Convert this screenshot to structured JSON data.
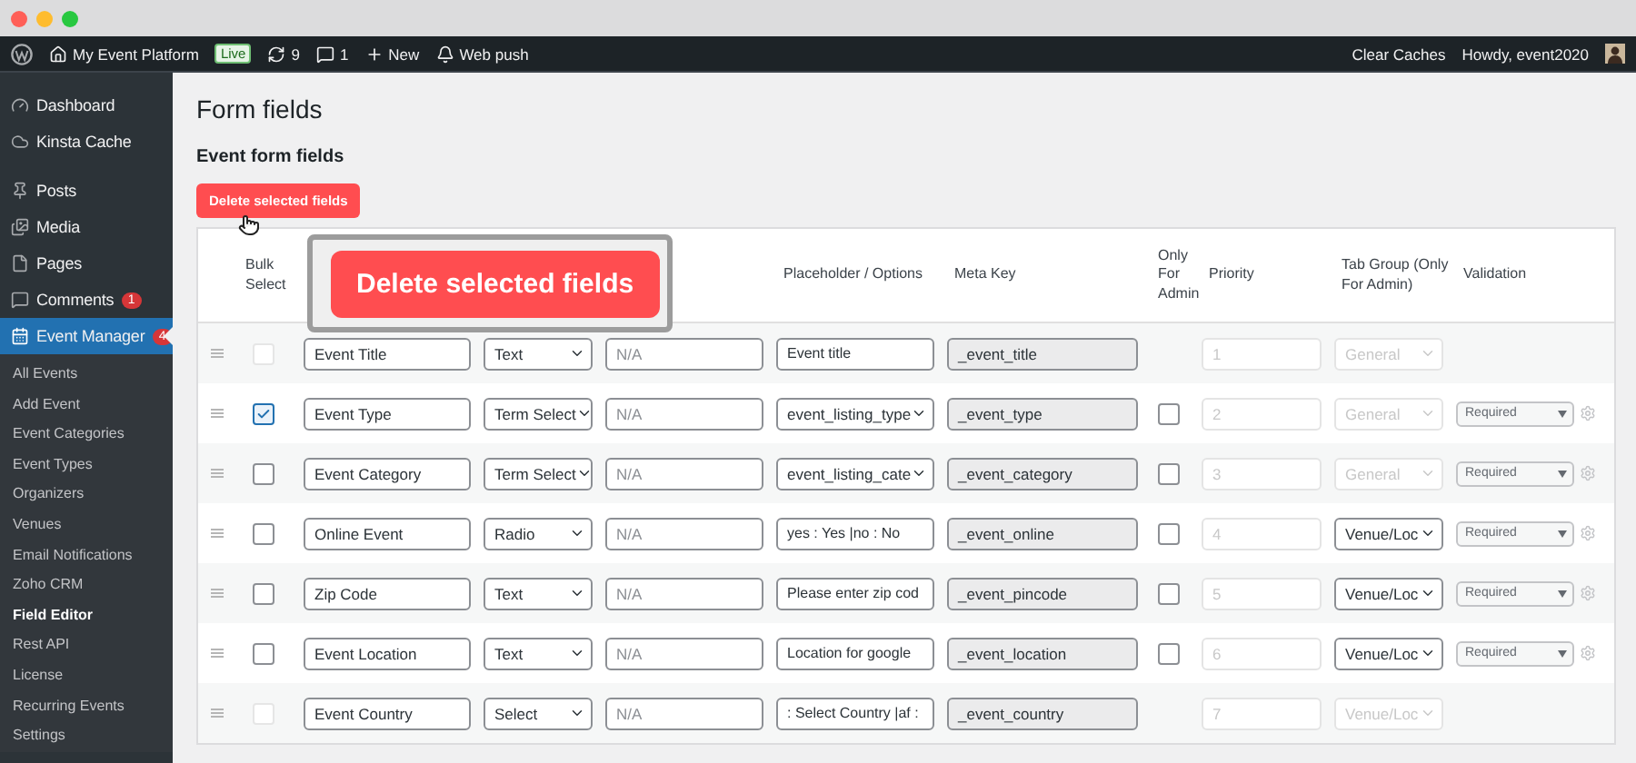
{
  "admin_bar": {
    "site": "My Event Platform",
    "badge": "Live",
    "updates": "9",
    "comments": "1",
    "new": "New",
    "push": "Web push",
    "clear": "Clear Caches",
    "greeting": "Howdy, event2020"
  },
  "sidebar": {
    "items": [
      {
        "label": "Dashboard",
        "selected": false
      },
      {
        "label": "Kinsta Cache",
        "selected": false
      },
      {
        "label": "Posts",
        "selected": false
      },
      {
        "label": "Media",
        "selected": false
      },
      {
        "label": "Pages",
        "selected": false
      },
      {
        "label": "Comments",
        "selected": false,
        "count": "1"
      },
      {
        "label": "Event Manager",
        "selected": true,
        "count": "4"
      }
    ],
    "submenu": [
      {
        "label": "All Events",
        "selected": false
      },
      {
        "label": "Add Event",
        "selected": false
      },
      {
        "label": "Event Categories",
        "selected": false
      },
      {
        "label": "Event Types",
        "selected": false
      },
      {
        "label": "Organizers",
        "selected": false
      },
      {
        "label": "Venues",
        "selected": false
      },
      {
        "label": "Email Notifications",
        "selected": false
      },
      {
        "label": "Zoho CRM",
        "selected": false
      },
      {
        "label": "Field Editor",
        "selected": true
      },
      {
        "label": "Rest API",
        "selected": false
      },
      {
        "label": "License",
        "selected": false
      },
      {
        "label": "Recurring Events",
        "selected": false
      },
      {
        "label": "Settings",
        "selected": false
      }
    ]
  },
  "page": {
    "title": "Form fields",
    "section": "Event form fields",
    "delete_button": "Delete selected fields",
    "popup_button": "Delete selected fields"
  },
  "table": {
    "headers": {
      "bulk_select": "Bulk Select",
      "placeholder_options": "Placeholder / Options",
      "meta_key": "Meta Key",
      "only_for_admin": "Only For Admin",
      "priority": "Priority",
      "tab_group": "Tab Group (Only For Admin)",
      "validation": "Validation"
    },
    "rows": [
      {
        "disabled": true,
        "selected": false,
        "label": "Event Title",
        "type": "Text",
        "description_placeholder": "N/A",
        "options": {
          "kind": "input",
          "value": "Event title"
        },
        "meta_key": "_event_title",
        "priority": "1",
        "tab_group": "General",
        "tab_group_disabled": true
      },
      {
        "disabled": false,
        "selected": true,
        "label": "Event Type",
        "type": "Term Select",
        "description_placeholder": "N/A",
        "options": {
          "kind": "select",
          "value": "event_listing_type"
        },
        "meta_key": "_event_type",
        "admin_only": false,
        "priority": "2",
        "tab_group": "General",
        "tab_group_disabled": true,
        "validation": "Required"
      },
      {
        "disabled": false,
        "selected": false,
        "label": "Event Category",
        "type": "Term Select",
        "description_placeholder": "N/A",
        "options": {
          "kind": "select",
          "value": "event_listing_cate"
        },
        "meta_key": "_event_category",
        "admin_only": false,
        "priority": "3",
        "tab_group": "General",
        "tab_group_disabled": true,
        "validation": "Required"
      },
      {
        "disabled": false,
        "selected": false,
        "label": "Online Event",
        "type": "Radio",
        "description_placeholder": "N/A",
        "options": {
          "kind": "input",
          "value": "yes : Yes |no : No"
        },
        "meta_key": "_event_online",
        "admin_only": false,
        "priority": "4",
        "tab_group": "Venue/Loc",
        "tab_group_disabled": false,
        "validation": "Required"
      },
      {
        "disabled": false,
        "selected": false,
        "label": "Zip Code",
        "type": "Text",
        "description_placeholder": "N/A",
        "options": {
          "kind": "input",
          "value": "Please enter zip cod"
        },
        "meta_key": "_event_pincode",
        "admin_only": false,
        "priority": "5",
        "tab_group": "Venue/Loc",
        "tab_group_disabled": false,
        "validation": "Required"
      },
      {
        "disabled": false,
        "selected": false,
        "label": "Event Location",
        "type": "Text",
        "description_placeholder": "N/A",
        "options": {
          "kind": "input",
          "value": "Location for google"
        },
        "meta_key": "_event_location",
        "admin_only": false,
        "priority": "6",
        "tab_group": "Venue/Loc",
        "tab_group_disabled": false,
        "validation": "Required"
      },
      {
        "disabled": true,
        "selected": false,
        "label": "Event Country",
        "type": "Select",
        "description_placeholder": "N/A",
        "options": {
          "kind": "input",
          "value": ": Select Country |af :"
        },
        "meta_key": "_event_country",
        "priority": "7",
        "tab_group": "Venue/Loc",
        "tab_group_disabled": true
      }
    ]
  }
}
